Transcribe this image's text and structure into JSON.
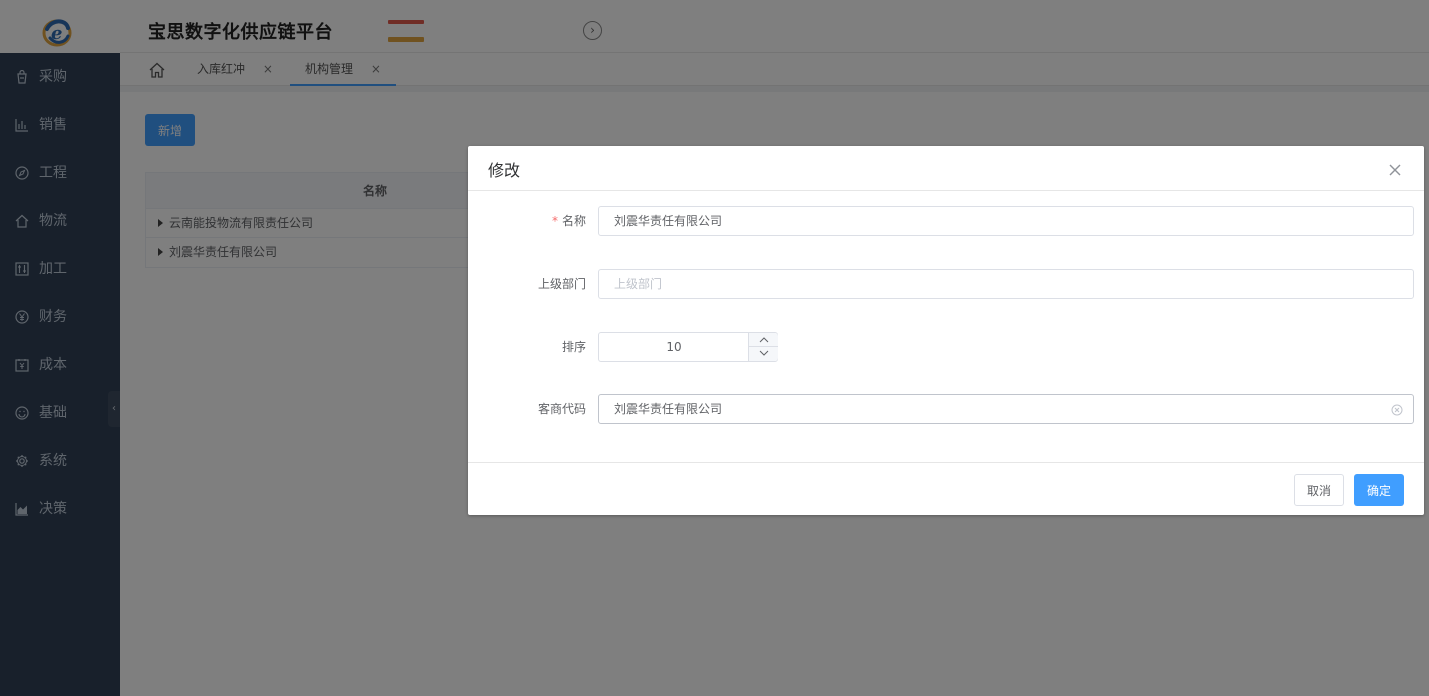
{
  "header": {
    "title": "宝思数字化供应链平台",
    "sub_text": "",
    "logo_letter": "e",
    "badge_colors": [
      "#e05a4d",
      "#e0a441"
    ],
    "collapse_glyph": "›"
  },
  "sidebar": {
    "items": [
      {
        "label": "采购",
        "icon": "shopping-bag-icon"
      },
      {
        "label": "销售",
        "icon": "bar-chart-icon"
      },
      {
        "label": "工程",
        "icon": "compass-icon"
      },
      {
        "label": "物流",
        "icon": "home-icon"
      },
      {
        "label": "加工",
        "icon": "sliders-icon"
      },
      {
        "label": "财务",
        "icon": "yen-icon"
      },
      {
        "label": "成本",
        "icon": "calendar-yen-icon"
      },
      {
        "label": "基础",
        "icon": "smile-icon"
      },
      {
        "label": "系统",
        "icon": "gear-icon"
      },
      {
        "label": "决策",
        "icon": "area-chart-icon"
      }
    ],
    "toggle_glyph": "‹"
  },
  "tabs": {
    "items": [
      {
        "label": "入库红冲",
        "close": "×",
        "active": false
      },
      {
        "label": "机构管理",
        "close": "×",
        "active": true
      }
    ]
  },
  "content": {
    "add_button": "新增",
    "table": {
      "header": "名称",
      "rows": [
        "云南能投物流有限责任公司",
        "刘震华责任有限公司"
      ]
    }
  },
  "dialog": {
    "title": "修改",
    "required_mark": "*",
    "fields": {
      "name": {
        "label": "名称",
        "value": "刘震华责任有限公司"
      },
      "parent": {
        "label": "上级部门",
        "placeholder": "上级部门"
      },
      "sort": {
        "label": "排序",
        "value": "10"
      },
      "code": {
        "label": "客商代码",
        "value": "刘震华责任有限公司"
      }
    },
    "cancel": "取消",
    "confirm": "确定"
  },
  "colors": {
    "primary": "#409eff",
    "sidebar_bg": "#304156",
    "sidebar_text": "#bfcbd9",
    "required": "#f56c6c"
  }
}
